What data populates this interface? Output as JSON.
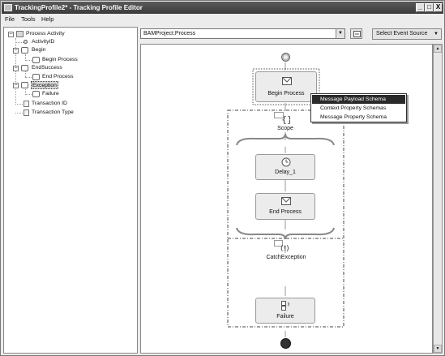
{
  "window": {
    "title": "TrackingProfile2* - Tracking Profile Editor",
    "controls": [
      "_",
      "□",
      "X"
    ]
  },
  "menu": {
    "items": [
      {
        "label": "File",
        "mnemonic": "F"
      },
      {
        "label": "Tools",
        "mnemonic": "T"
      },
      {
        "label": "Help",
        "mnemonic": "H"
      }
    ]
  },
  "tree": {
    "nodes": [
      {
        "label": "Process Activity",
        "icon": "folder-icon",
        "expander": "−"
      },
      {
        "label": "ActivityID",
        "icon": "key-icon"
      },
      {
        "label": "Begin",
        "icon": "shape-icon",
        "expander": "−"
      },
      {
        "label": "Begin Process",
        "icon": "shape-icon"
      },
      {
        "label": "EndSuccess",
        "icon": "shape-icon",
        "expander": "−"
      },
      {
        "label": "End Process",
        "icon": "shape-icon"
      },
      {
        "label": "Exception",
        "icon": "shape-icon",
        "expander": "−",
        "selected": true
      },
      {
        "label": "Failure",
        "icon": "shape-icon"
      },
      {
        "label": "Transaction ID",
        "icon": "doc-icon"
      },
      {
        "label": "Transaction Type",
        "icon": "doc-icon"
      }
    ]
  },
  "toolbar": {
    "process_combo_value": "BAMProject.Process",
    "select_event_source_label": "Select Event Source",
    "select_event_source_mnemonic": "S"
  },
  "workflow": {
    "begin_process_label": "Begin Process",
    "scope_label": "Scope",
    "delay_label": "Delay_1",
    "end_process_label": "End Process",
    "catch_label": "CatchException",
    "failure_label": "Failure"
  },
  "context_menu": {
    "items": [
      {
        "label": "Message Payload Schema",
        "mnemonic": "M",
        "highlighted": true
      },
      {
        "label": "Context Property Schemas",
        "mnemonic": "C",
        "highlighted": false
      },
      {
        "label": "Message Property Schema",
        "mnemonic": "P",
        "highlighted": false
      }
    ]
  },
  "colors": {
    "titlebar": "#3b3b3b",
    "canvas_bg": "#ffffff",
    "menu_highlight": "#2a2a2a",
    "end_node": "#333333"
  }
}
